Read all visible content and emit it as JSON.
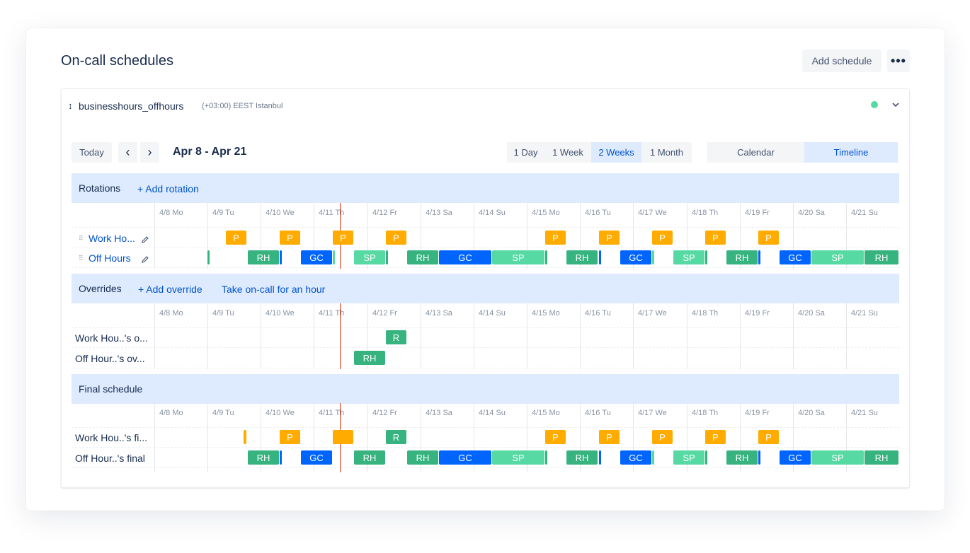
{
  "page": {
    "title": "On-call schedules",
    "add_schedule": "Add schedule",
    "more": "•••"
  },
  "schedule": {
    "name": "businesshours_offhours",
    "timezone": "(+03:00) EEST Istanbul",
    "status_color": "#57D9A3"
  },
  "toolbar": {
    "today": "Today",
    "prev": "‹",
    "next": "›",
    "date_range": "Apr 8 - Apr 21",
    "ranges": [
      "1 Day",
      "1 Week",
      "2 Weeks",
      "1 Month"
    ],
    "selected_range": "2 Weeks",
    "views": [
      "Calendar",
      "Timeline"
    ],
    "selected_view": "Timeline"
  },
  "days": [
    "4/8 Mo",
    "4/9 Tu",
    "4/10 We",
    "4/11 Th",
    "4/12 Fr",
    "4/13 Sa",
    "4/14 Su",
    "4/15 Mo",
    "4/16 Tu",
    "4/17 We",
    "4/18 Th",
    "4/19 Fr",
    "4/20 Sa",
    "4/21 Su"
  ],
  "colors": {
    "P": "#FFAB00",
    "RH": "#36B37E",
    "GC": "#0065FF",
    "SP": "#57D9A3",
    "R": "#36B37E",
    "now_line": "#DE350B"
  },
  "rotations": {
    "title": "Rotations",
    "add_link": "+ Add rotation",
    "rows": [
      {
        "label": "Work Ho...",
        "blocks": [
          {
            "t": "P",
            "s": 1.35,
            "e": 1.75
          },
          {
            "t": "P",
            "s": 2.35,
            "e": 2.75
          },
          {
            "t": "P",
            "s": 3.35,
            "e": 3.75
          },
          {
            "t": "P",
            "s": 4.35,
            "e": 4.75
          },
          {
            "t": "P",
            "s": 7.35,
            "e": 7.75
          },
          {
            "t": "P",
            "s": 8.35,
            "e": 8.75
          },
          {
            "t": "P",
            "s": 9.35,
            "e": 9.75
          },
          {
            "t": "P",
            "s": 10.35,
            "e": 10.75
          },
          {
            "t": "P",
            "s": 11.35,
            "e": 11.75
          }
        ]
      },
      {
        "label": "Off Hours",
        "blocks": [
          {
            "t": "RH",
            "s": 1.0,
            "e": 1.04,
            "x": ""
          },
          {
            "t": "RH",
            "s": 1.75,
            "e": 2.35
          },
          {
            "t": "GC",
            "s": 2.35,
            "e": 2.4,
            "x": ""
          },
          {
            "t": "GC",
            "s": 2.75,
            "e": 3.35
          },
          {
            "t": "SP",
            "s": 3.35,
            "e": 3.4,
            "x": ""
          },
          {
            "t": "SP",
            "s": 3.75,
            "e": 4.35
          },
          {
            "t": "RH",
            "s": 4.35,
            "e": 4.4,
            "x": ""
          },
          {
            "t": "RH",
            "s": 4.75,
            "e": 5.35
          },
          {
            "t": "GC",
            "s": 5.35,
            "e": 6.35
          },
          {
            "t": "SP",
            "s": 6.35,
            "e": 7.35
          },
          {
            "t": "RH",
            "s": 7.35,
            "e": 7.4,
            "x": ""
          },
          {
            "t": "RH",
            "s": 7.75,
            "e": 8.35
          },
          {
            "t": "GC",
            "s": 8.35,
            "e": 8.4,
            "x": ""
          },
          {
            "t": "GC",
            "s": 8.75,
            "e": 9.35
          },
          {
            "t": "SP",
            "s": 9.35,
            "e": 9.4,
            "x": ""
          },
          {
            "t": "SP",
            "s": 9.75,
            "e": 10.35
          },
          {
            "t": "RH",
            "s": 10.35,
            "e": 10.4,
            "x": ""
          },
          {
            "t": "RH",
            "s": 10.75,
            "e": 11.35
          },
          {
            "t": "GC",
            "s": 11.35,
            "e": 11.4,
            "x": ""
          },
          {
            "t": "GC",
            "s": 11.75,
            "e": 12.35
          },
          {
            "t": "SP",
            "s": 12.35,
            "e": 13.35
          },
          {
            "t": "RH",
            "s": 13.35,
            "e": 14.0
          }
        ]
      }
    ]
  },
  "overrides": {
    "title": "Overrides",
    "add_link": "+ Add override",
    "take_link": "Take on-call for an hour",
    "rows": [
      {
        "label": "Work Hou..'s o...",
        "blocks": [
          {
            "t": "R",
            "s": 4.35,
            "e": 4.75
          }
        ]
      },
      {
        "label": "Off Hour..'s ov...",
        "blocks": [
          {
            "t": "RH",
            "s": 3.75,
            "e": 4.35
          }
        ]
      }
    ]
  },
  "final": {
    "title": "Final schedule",
    "rows": [
      {
        "label": "Work Hou..'s fi...",
        "blocks": [
          {
            "t": "P",
            "s": 1.68,
            "e": 1.75,
            "x": ""
          },
          {
            "t": "P",
            "s": 2.35,
            "e": 2.75
          },
          {
            "t": "P",
            "s": 3.35,
            "e": 3.75,
            "x": ""
          },
          {
            "t": "R",
            "s": 4.35,
            "e": 4.75
          },
          {
            "t": "P",
            "s": 7.35,
            "e": 7.75
          },
          {
            "t": "P",
            "s": 8.35,
            "e": 8.75
          },
          {
            "t": "P",
            "s": 9.35,
            "e": 9.75
          },
          {
            "t": "P",
            "s": 10.35,
            "e": 10.75
          },
          {
            "t": "P",
            "s": 11.35,
            "e": 11.75
          }
        ]
      },
      {
        "label": "Off Hour..'s final",
        "blocks": [
          {
            "t": "RH",
            "s": 1.75,
            "e": 2.35
          },
          {
            "t": "GC",
            "s": 2.35,
            "e": 2.4,
            "x": ""
          },
          {
            "t": "GC",
            "s": 2.75,
            "e": 3.35
          },
          {
            "t": "RH",
            "s": 3.75,
            "e": 4.35
          },
          {
            "t": "RH",
            "s": 4.75,
            "e": 5.35
          },
          {
            "t": "GC",
            "s": 5.35,
            "e": 6.35
          },
          {
            "t": "SP",
            "s": 6.35,
            "e": 7.35
          },
          {
            "t": "RH",
            "s": 7.35,
            "e": 7.4,
            "x": ""
          },
          {
            "t": "RH",
            "s": 7.75,
            "e": 8.35
          },
          {
            "t": "GC",
            "s": 8.35,
            "e": 8.4,
            "x": ""
          },
          {
            "t": "GC",
            "s": 8.75,
            "e": 9.35
          },
          {
            "t": "SP",
            "s": 9.35,
            "e": 9.4,
            "x": ""
          },
          {
            "t": "SP",
            "s": 9.75,
            "e": 10.35
          },
          {
            "t": "RH",
            "s": 10.35,
            "e": 10.4,
            "x": ""
          },
          {
            "t": "RH",
            "s": 10.75,
            "e": 11.35
          },
          {
            "t": "GC",
            "s": 11.35,
            "e": 11.4,
            "x": ""
          },
          {
            "t": "GC",
            "s": 11.75,
            "e": 12.35
          },
          {
            "t": "SP",
            "s": 12.35,
            "e": 13.35
          },
          {
            "t": "RH",
            "s": 13.35,
            "e": 14.0
          }
        ]
      }
    ]
  },
  "now_day_offset": 3.35
}
